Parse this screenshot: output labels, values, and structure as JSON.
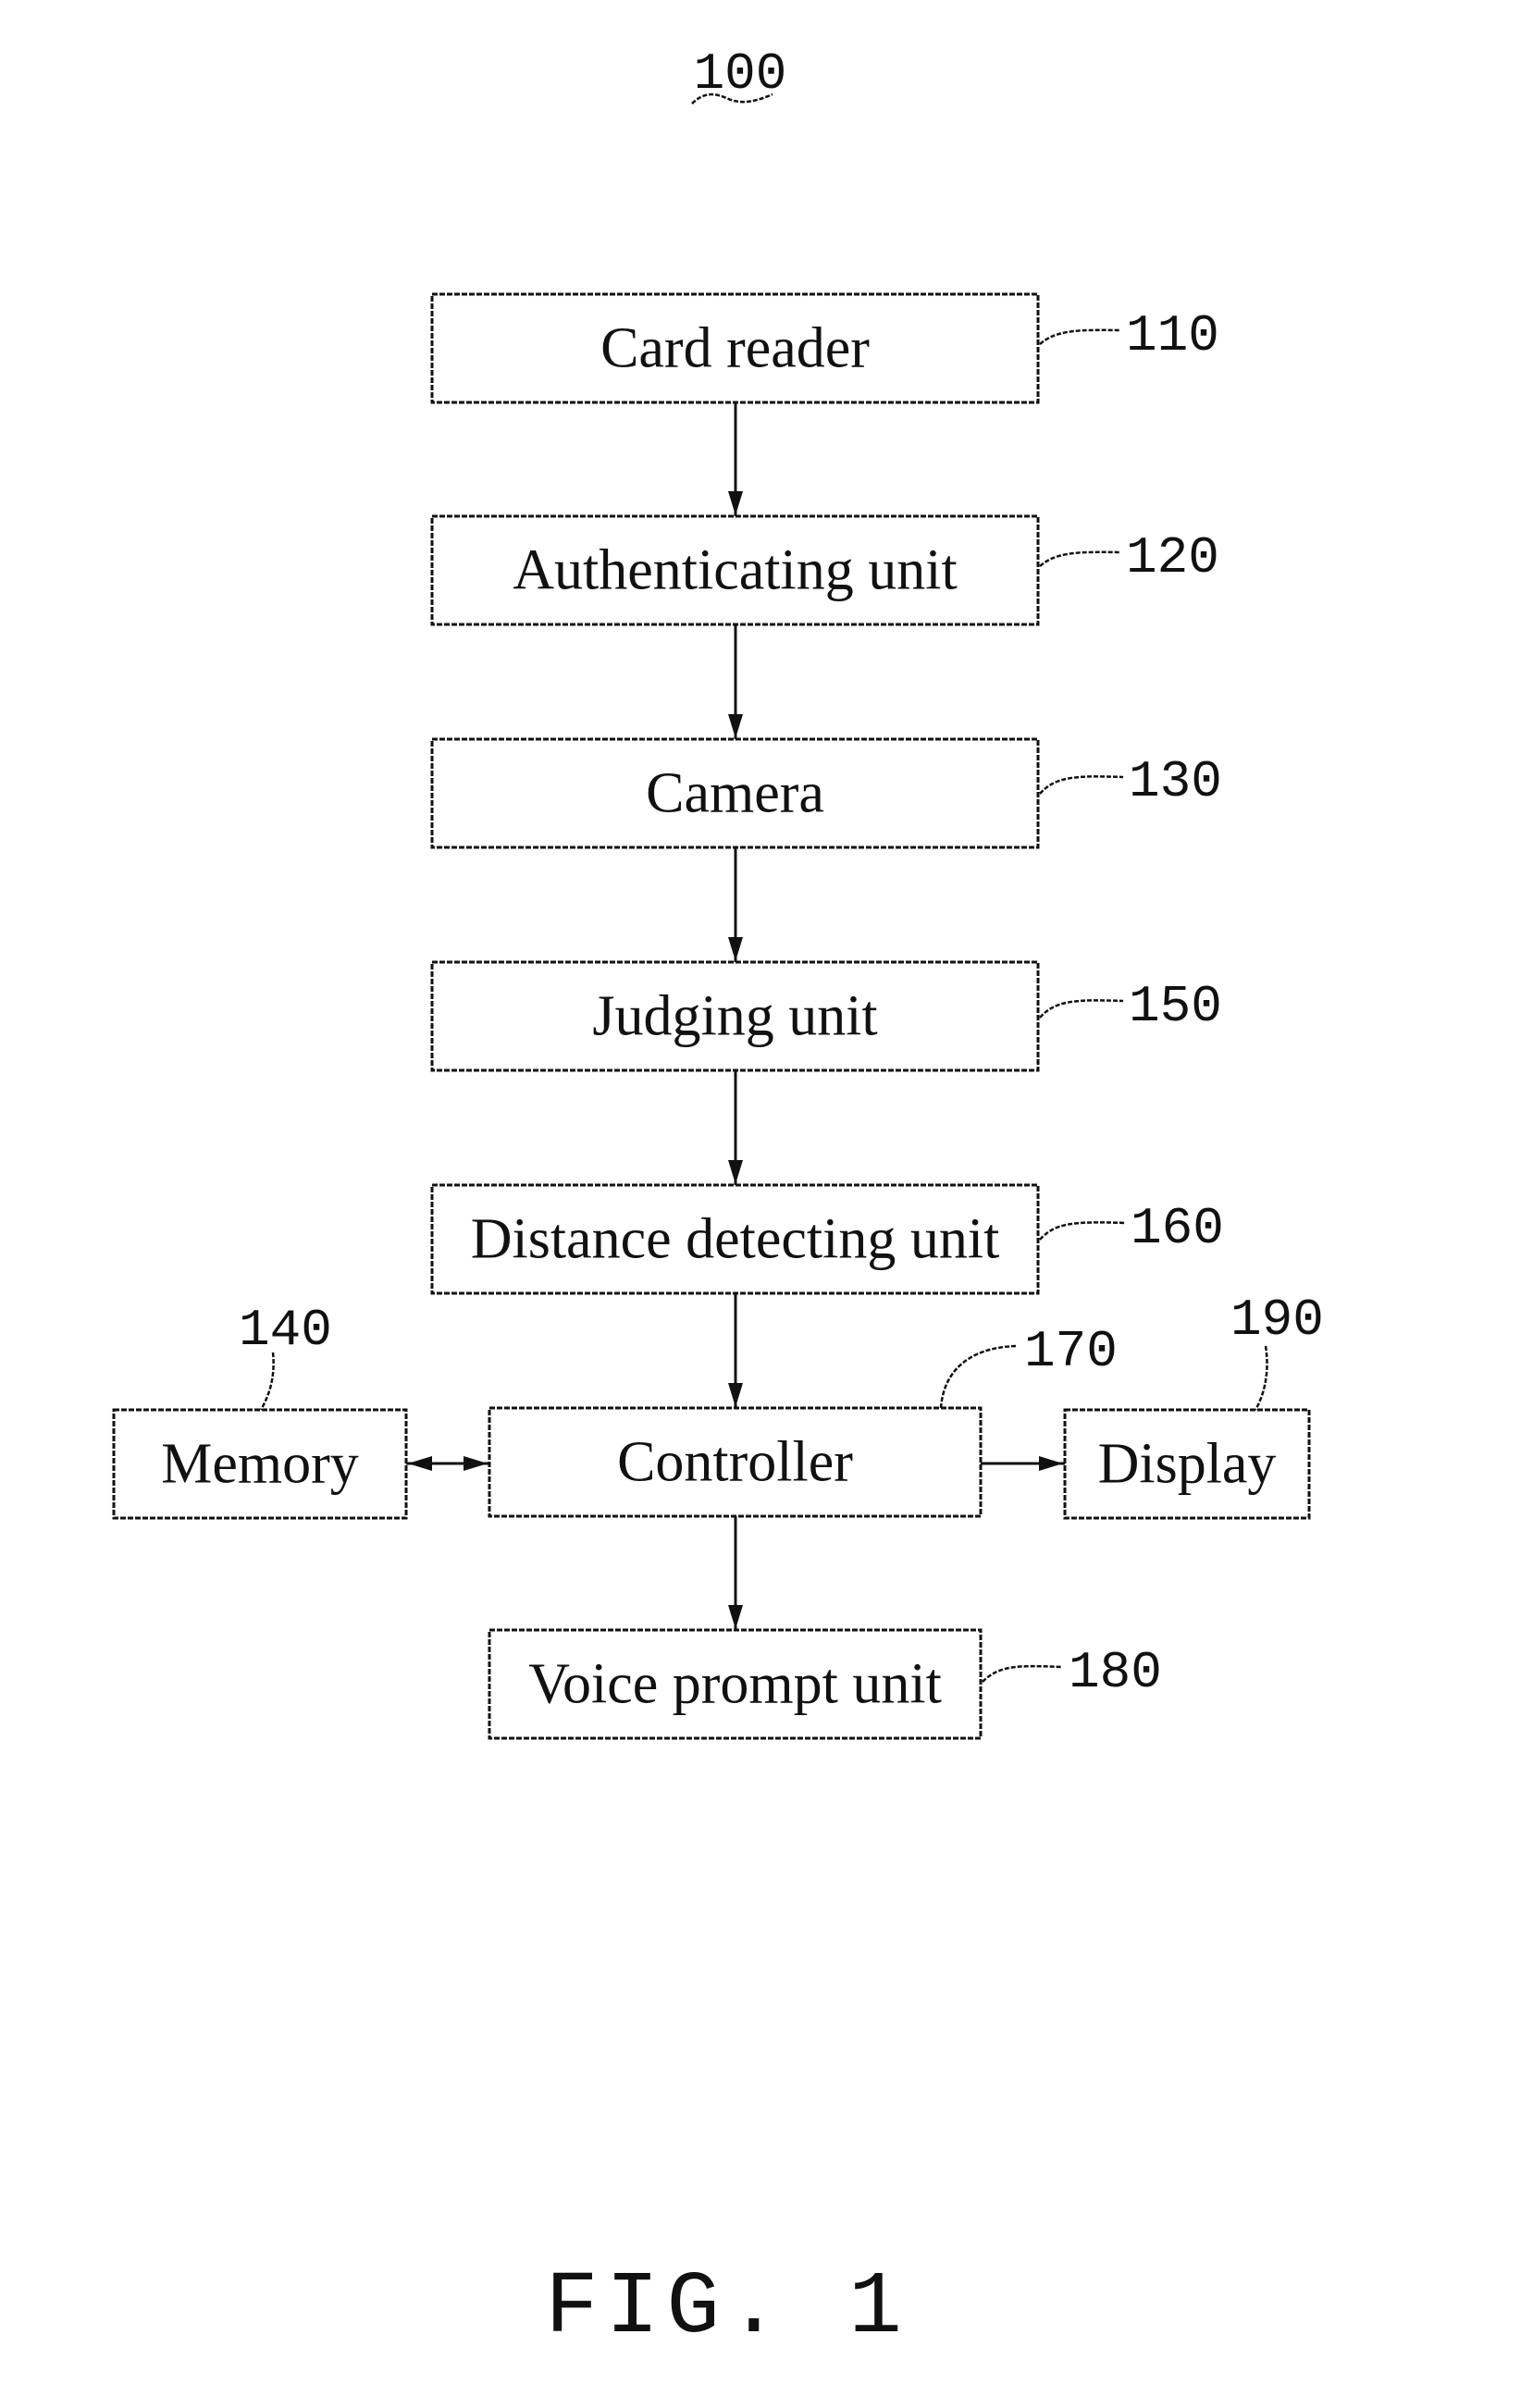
{
  "figure": {
    "reference_numeral": "100",
    "caption": "FIG. 1"
  },
  "blocks": [
    {
      "id": "card_reader",
      "label": "Card reader",
      "ref": "110"
    },
    {
      "id": "authenticating_unit",
      "label": "Authenticating unit",
      "ref": "120"
    },
    {
      "id": "camera",
      "label": "Camera",
      "ref": "130"
    },
    {
      "id": "judging_unit",
      "label": "Judging unit",
      "ref": "150"
    },
    {
      "id": "distance_detecting_unit",
      "label": "Distance detecting unit",
      "ref": "160"
    },
    {
      "id": "memory",
      "label": "Memory",
      "ref": "140"
    },
    {
      "id": "controller",
      "label": "Controller",
      "ref": "170"
    },
    {
      "id": "display",
      "label": "Display",
      "ref": "190"
    },
    {
      "id": "voice_prompt_unit",
      "label": "Voice prompt unit",
      "ref": "180"
    }
  ],
  "connections": [
    {
      "from": "card_reader",
      "to": "authenticating_unit",
      "direction": "forward"
    },
    {
      "from": "authenticating_unit",
      "to": "camera",
      "direction": "forward"
    },
    {
      "from": "camera",
      "to": "judging_unit",
      "direction": "forward"
    },
    {
      "from": "judging_unit",
      "to": "distance_detecting_unit",
      "direction": "forward"
    },
    {
      "from": "distance_detecting_unit",
      "to": "controller",
      "direction": "forward"
    },
    {
      "from": "controller",
      "to": "memory",
      "direction": "bidirectional"
    },
    {
      "from": "controller",
      "to": "display",
      "direction": "forward"
    },
    {
      "from": "controller",
      "to": "voice_prompt_unit",
      "direction": "forward"
    }
  ]
}
